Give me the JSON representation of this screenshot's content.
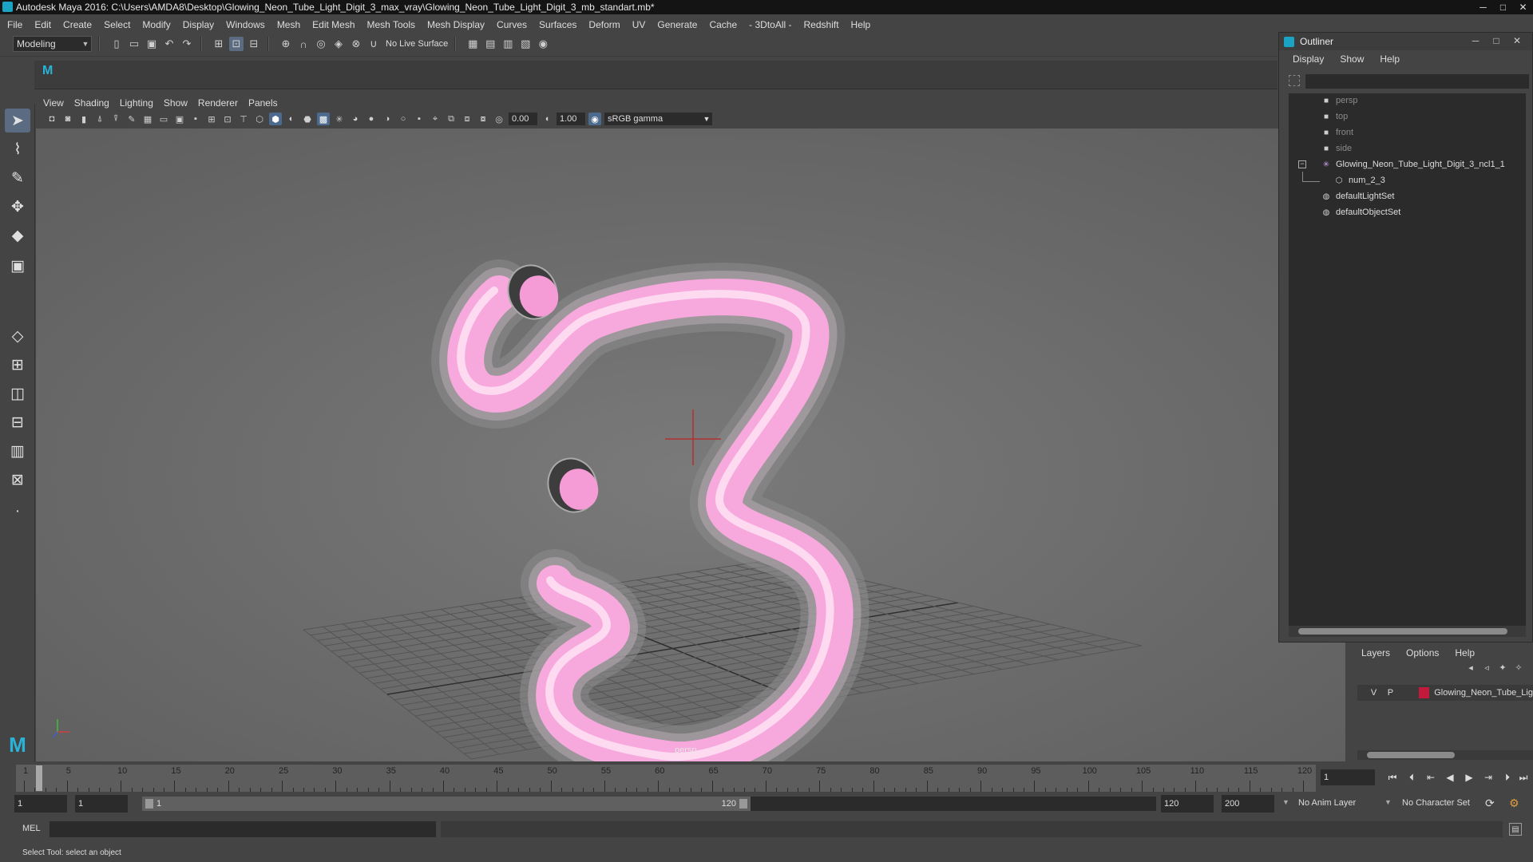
{
  "window": {
    "title": "Autodesk Maya 2016: C:\\Users\\AMDA8\\Desktop\\Glowing_Neon_Tube_Light_Digit_3_max_vray\\Glowing_Neon_Tube_Light_Digit_3_mb_standart.mb*",
    "minimize": "─",
    "maximize": "□",
    "close": "✕"
  },
  "menubar": [
    "File",
    "Edit",
    "Create",
    "Select",
    "Modify",
    "Display",
    "Windows",
    "Mesh",
    "Edit Mesh",
    "Mesh Tools",
    "Mesh Display",
    "Curves",
    "Surfaces",
    "Deform",
    "UV",
    "Generate",
    "Cache",
    "- 3DtoAll -",
    "Redshift",
    "Help"
  ],
  "statusline": {
    "mode": "Modeling",
    "live_surface": "No Live Surface"
  },
  "panel_menu": [
    "View",
    "Shading",
    "Lighting",
    "Show",
    "Renderer",
    "Panels"
  ],
  "viewport_toolbar": {
    "exposure": "0.00",
    "gamma": "1.00",
    "color_space": "sRGB gamma"
  },
  "viewport": {
    "camera_label": "persp",
    "neon_color": "#ffb8e6",
    "glow_color": "#c9c9c9"
  },
  "outliner": {
    "title": "Outliner",
    "menu": [
      "Display",
      "Show",
      "Help"
    ],
    "items": [
      {
        "label": "persp",
        "icon": "camera-icon",
        "dim": true
      },
      {
        "label": "top",
        "icon": "camera-icon",
        "dim": true
      },
      {
        "label": "front",
        "icon": "camera-icon",
        "dim": true
      },
      {
        "label": "side",
        "icon": "camera-icon",
        "dim": true
      },
      {
        "label": "Glowing_Neon_Tube_Light_Digit_3_ncl1_1",
        "icon": "group-icon",
        "dim": false
      },
      {
        "label": "num_2_3",
        "icon": "mesh-icon",
        "dim": false
      },
      {
        "label": "defaultLightSet",
        "icon": "set-icon",
        "dim": false
      },
      {
        "label": "defaultObjectSet",
        "icon": "set-icon",
        "dim": false
      }
    ],
    "expand_symbol": "−"
  },
  "layers": {
    "menu": [
      "Layers",
      "Options",
      "Help"
    ],
    "row": {
      "v": "V",
      "p": "P",
      "name": "Glowing_Neon_Tube_Lig",
      "color": "#c21a3a"
    }
  },
  "timeline": {
    "ticks": [
      1,
      5,
      10,
      15,
      20,
      25,
      30,
      35,
      40,
      45,
      50,
      55,
      60,
      65,
      70,
      75,
      80,
      85,
      90,
      95,
      100,
      105,
      110,
      115,
      120
    ],
    "current_frame": "1"
  },
  "range": {
    "start": "1",
    "playback_start": "1",
    "handle_start": "1",
    "handle_end": "120",
    "playback_end": "120",
    "end": "200",
    "anim_layer": "No Anim Layer",
    "character_set": "No Character Set"
  },
  "cmdline": {
    "lang": "MEL"
  },
  "helpline": {
    "text": "Select Tool: select an object"
  }
}
